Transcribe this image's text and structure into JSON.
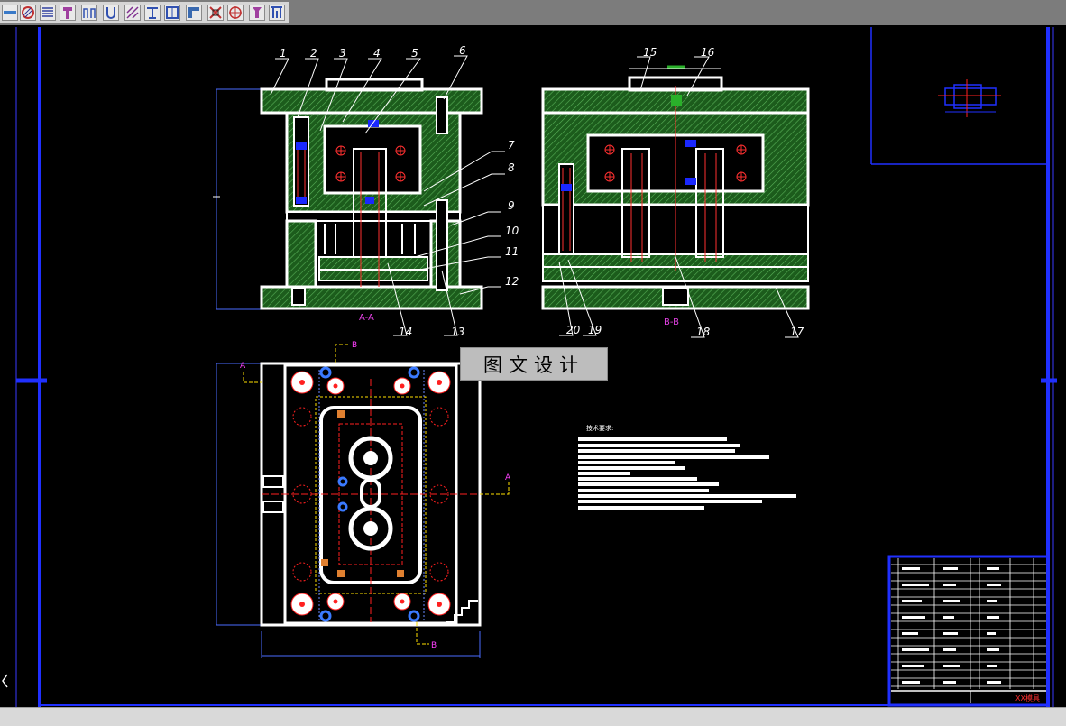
{
  "toolbar": {
    "icons": [
      "line-tool-icon",
      "hatch-icon",
      "stripes-icon",
      "bolt-icon",
      "slot-icon",
      "magnet-icon",
      "diagonal-hatch-icon",
      "beam-icon",
      "frame-icon",
      "channel-icon",
      "dimension-icon",
      "crosshair-icon",
      "screw-icon",
      "split-icon"
    ]
  },
  "drawing": {
    "part_numbers": [
      "1",
      "2",
      "3",
      "4",
      "5",
      "6",
      "7",
      "8",
      "9",
      "10",
      "11",
      "12",
      "13",
      "14",
      "15",
      "16",
      "17",
      "18",
      "19",
      "20"
    ],
    "section_aa_label": "A-A",
    "section_bb_label": "B-B",
    "section_marks": {
      "a": "A",
      "b": "B"
    },
    "tech_requirements_title": "技术要求:",
    "title_block_name": "XX模具"
  },
  "watermark": {
    "text": "图文设计"
  },
  "colors": {
    "background": "#000000",
    "outline": "#ffffff",
    "hatch": "#2a7a2a",
    "border_blue": "#2030ff",
    "centerline_red": "#ff2020",
    "dimension_yellow": "#ffe000",
    "label_magenta": "#ff40ff"
  }
}
